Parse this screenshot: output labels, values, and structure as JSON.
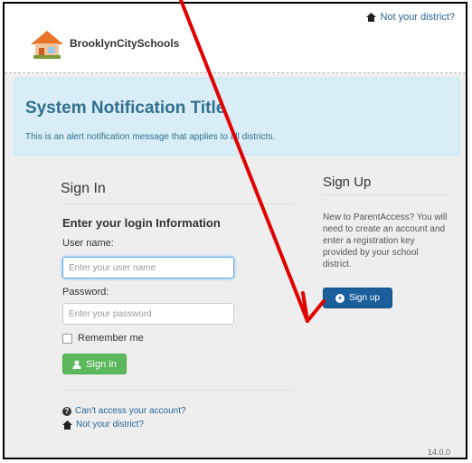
{
  "header": {
    "brand": "BrooklynCitySchools",
    "top_link": "Not your district?"
  },
  "alert": {
    "title": "System Notification Title",
    "message": "This is an alert notification message that applies to all districts."
  },
  "signin": {
    "title": "Sign In",
    "heading": "Enter your login Information",
    "username_label": "User name:",
    "username_placeholder": "Enter your user name",
    "password_label": "Password:",
    "password_placeholder": "Enter your password",
    "remember_label": "Remember me",
    "button_label": "Sign in",
    "help_link": "Can't access your account?",
    "district_link": "Not your district?"
  },
  "signup": {
    "title": "Sign Up",
    "text": "New to ParentAccess? You will need to create an account and enter a registration key provided by your school district.",
    "button_label": "Sign up"
  },
  "footer": {
    "version": "14.0.0"
  },
  "colors": {
    "annotation_arrow": "#e00000"
  }
}
